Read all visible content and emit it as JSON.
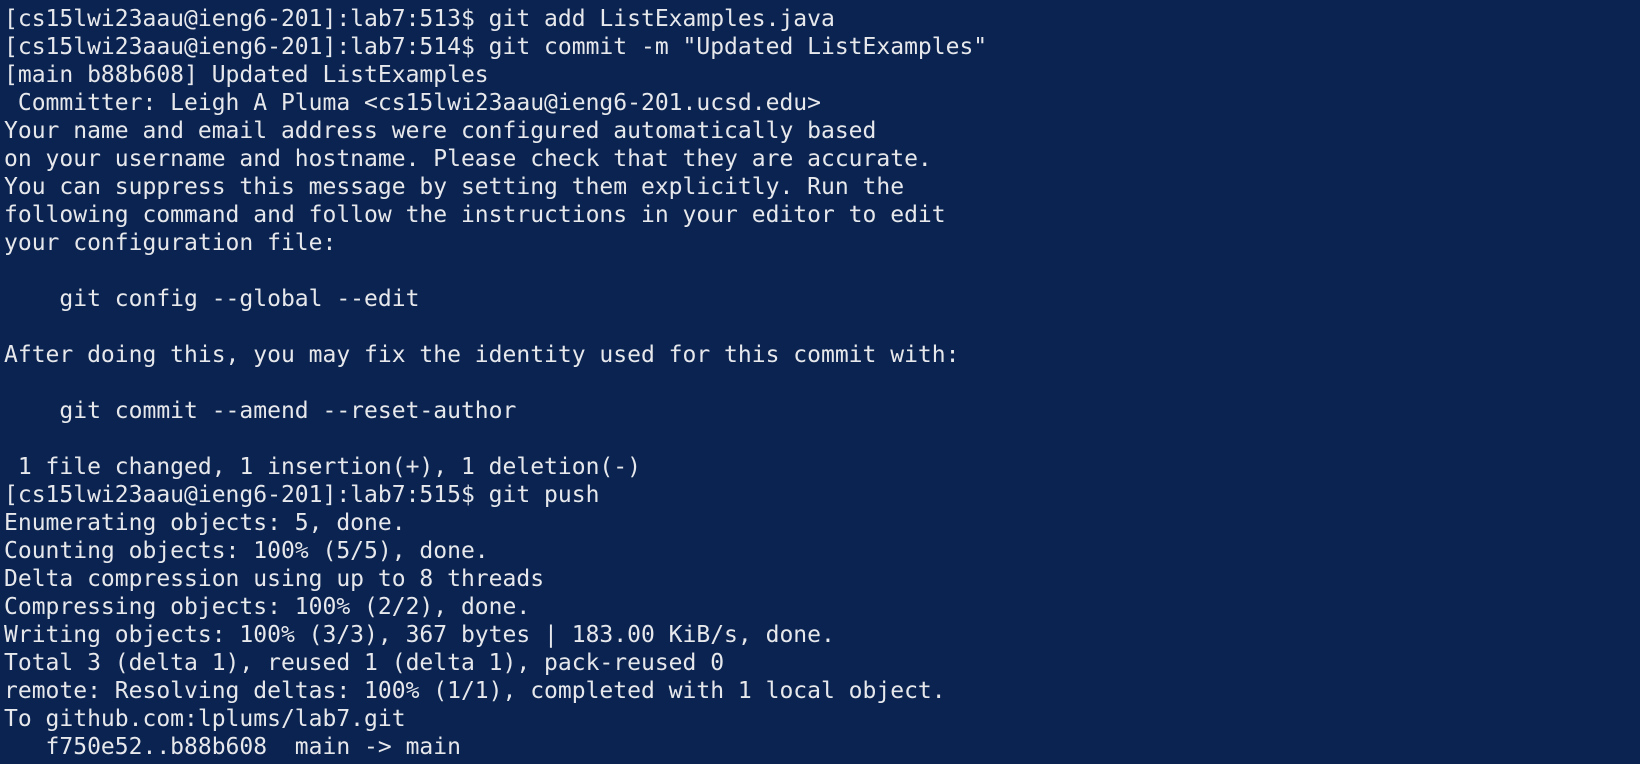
{
  "terminal": {
    "background": "#0b2350",
    "foreground": "#e6e8ec",
    "lines": [
      "[cs15lwi23aau@ieng6-201]:lab7:513$ git add ListExamples.java",
      "[cs15lwi23aau@ieng6-201]:lab7:514$ git commit -m \"Updated ListExamples\"",
      "[main b88b608] Updated ListExamples",
      " Committer: Leigh A Pluma <cs15lwi23aau@ieng6-201.ucsd.edu>",
      "Your name and email address were configured automatically based",
      "on your username and hostname. Please check that they are accurate.",
      "You can suppress this message by setting them explicitly. Run the",
      "following command and follow the instructions in your editor to edit",
      "your configuration file:",
      "",
      "    git config --global --edit",
      "",
      "After doing this, you may fix the identity used for this commit with:",
      "",
      "    git commit --amend --reset-author",
      "",
      " 1 file changed, 1 insertion(+), 1 deletion(-)",
      "[cs15lwi23aau@ieng6-201]:lab7:515$ git push",
      "Enumerating objects: 5, done.",
      "Counting objects: 100% (5/5), done.",
      "Delta compression using up to 8 threads",
      "Compressing objects: 100% (2/2), done.",
      "Writing objects: 100% (3/3), 367 bytes | 183.00 KiB/s, done.",
      "Total 3 (delta 1), reused 1 (delta 1), pack-reused 0",
      "remote: Resolving deltas: 100% (1/1), completed with 1 local object.",
      "To github.com:lplums/lab7.git",
      "   f750e52..b88b608  main -> main"
    ]
  }
}
